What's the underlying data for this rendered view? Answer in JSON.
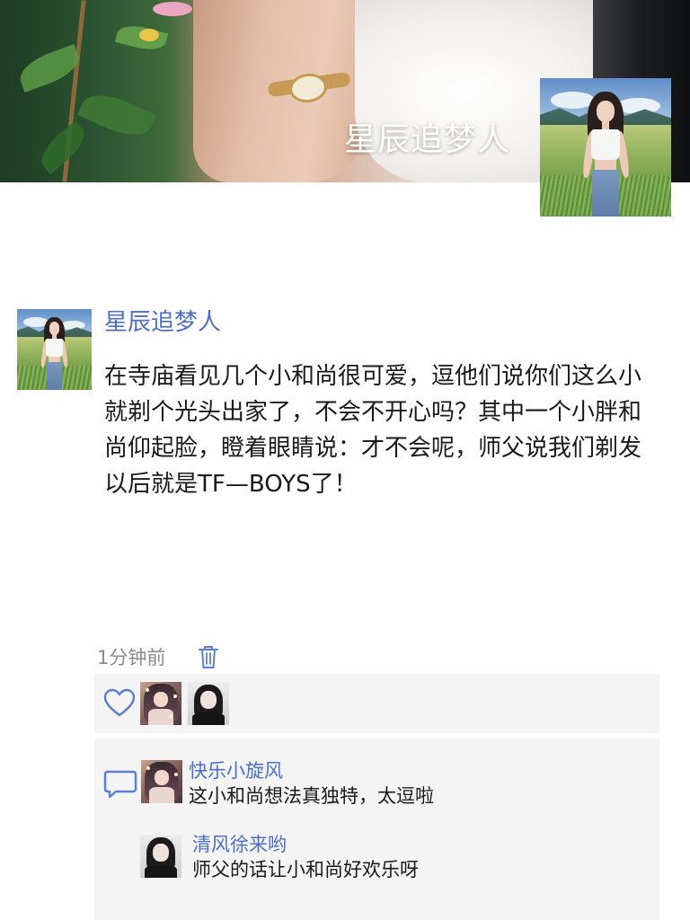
{
  "profile": {
    "display_name": "星辰追梦人"
  },
  "post": {
    "author": "星辰追梦人",
    "text": "在寺庙看见几个小和尚很可爱，逗他们说你们这么小就剃个光头出家了，不会不开心吗？其中一个小胖和尚仰起脸，瞪着眼睛说：才不会呢，师父说我们剃发以后就是TF—BOYS了！",
    "time": "1分钟前"
  },
  "likes": {
    "avatars": [
      "fantasy-girl-avatar",
      "bw-portrait-avatar"
    ]
  },
  "comments": [
    {
      "name": "快乐小旋风",
      "text": "这小和尚想法真独特，太逗啦",
      "avatar": "fantasy-girl-avatar"
    },
    {
      "name": "清风徐来哟",
      "text": "师父的话让小和尚好欢乐呀",
      "avatar": "bw-portrait-avatar"
    }
  ],
  "icons": {
    "delete": "trash-icon",
    "like": "heart-icon",
    "comment": "comment-bubble-icon"
  },
  "colors": {
    "link_blue": "#4c6fbf",
    "panel_bg": "#f4f4f4",
    "meta_gray": "#8a8a8a",
    "body_text": "#1a1a1a"
  }
}
